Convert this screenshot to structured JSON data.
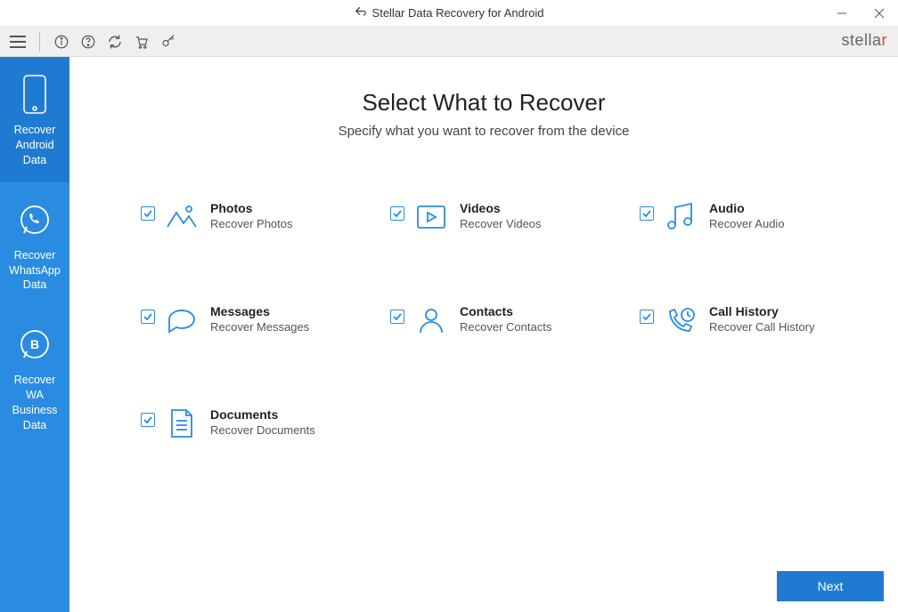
{
  "titlebar": {
    "title": "Stellar Data Recovery for Android"
  },
  "sidebar": {
    "items": [
      {
        "label": "Recover\nAndroid Data"
      },
      {
        "label": "Recover\nWhatsApp Data"
      },
      {
        "label": "Recover\nWA Business Data"
      }
    ]
  },
  "main": {
    "heading": "Select What to Recover",
    "subtitle": "Specify what you want to recover from the device",
    "options": [
      {
        "title": "Photos",
        "desc": "Recover Photos"
      },
      {
        "title": "Videos",
        "desc": "Recover Videos"
      },
      {
        "title": "Audio",
        "desc": "Recover Audio"
      },
      {
        "title": "Messages",
        "desc": "Recover Messages"
      },
      {
        "title": "Contacts",
        "desc": "Recover Contacts"
      },
      {
        "title": "Call History",
        "desc": "Recover Call History"
      },
      {
        "title": "Documents",
        "desc": "Recover Documents"
      }
    ],
    "next_label": "Next"
  },
  "logo": {
    "text_pre": "stella",
    "text_accent": "r"
  }
}
